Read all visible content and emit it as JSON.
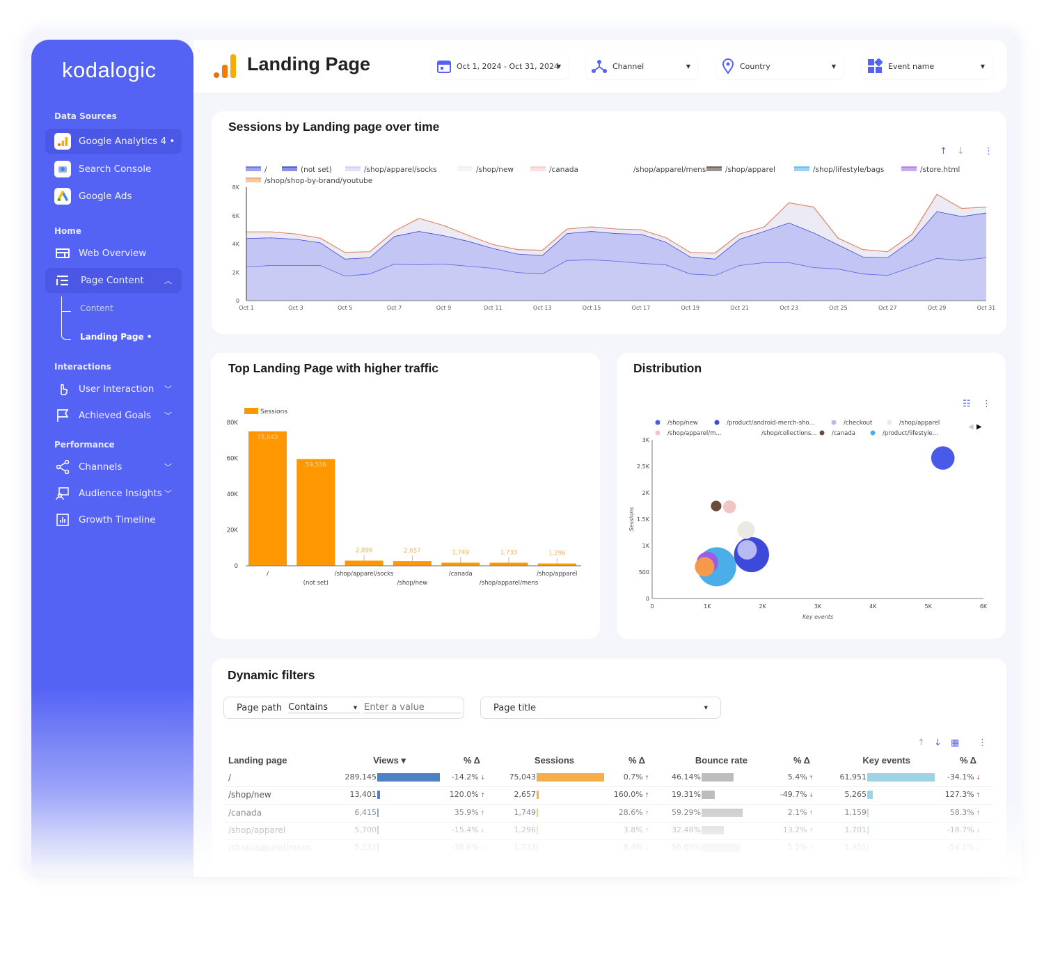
{
  "brand": "kodalogic",
  "sidebar": {
    "sections": [
      "Data Sources",
      "Home",
      "Interactions",
      "Performance"
    ],
    "data_sources": [
      {
        "label": "Google Analytics 4 •",
        "icon": "google-analytics-icon"
      },
      {
        "label": "Search Console",
        "icon": "search-console-icon"
      },
      {
        "label": "Google Ads",
        "icon": "google-ads-icon"
      }
    ],
    "home": [
      {
        "label": "Web Overview",
        "icon": "layout-icon"
      },
      {
        "label": "Page Content",
        "icon": "list-icon"
      }
    ],
    "page_content_children": [
      "Content",
      "Landing Page •"
    ],
    "interactions": [
      {
        "label": "User Interaction",
        "icon": "hand-pointer-icon"
      },
      {
        "label": "Achieved Goals",
        "icon": "flag-icon"
      }
    ],
    "performance": [
      {
        "label": "Channels",
        "icon": "share-icon"
      },
      {
        "label": "Audience Insights",
        "icon": "audience-icon"
      },
      {
        "label": "Growth Timeline",
        "icon": "bar-chart-icon"
      }
    ]
  },
  "header": {
    "title": "Landing Page",
    "filters": [
      {
        "label": "Oct 1, 2024 - Oct 31, 2024",
        "icon": "calendar-icon"
      },
      {
        "label": "Channel",
        "icon": "channel-icon"
      },
      {
        "label": "Country",
        "icon": "location-pin-icon"
      },
      {
        "label": "Event name",
        "icon": "widgets-icon"
      }
    ]
  },
  "colors": {
    "sidebar": "#5563f5",
    "accent_orange": "#ff9800",
    "table_views": "#4f81c7",
    "table_sessions": "#f6ae4a",
    "table_bounce": "#bdbdbd",
    "table_key": "#9fd3e3"
  },
  "chart_data": [
    {
      "type": "area",
      "title": "Sessions by Landing page over time",
      "stacked": true,
      "ylim": [
        0,
        8000
      ],
      "yticks": [
        "0",
        "2K",
        "4K",
        "6K",
        "8K"
      ],
      "x": [
        "Oct 1",
        "Oct 2",
        "Oct 3",
        "Oct 4",
        "Oct 5",
        "Oct 6",
        "Oct 7",
        "Oct 8",
        "Oct 9",
        "Oct 10",
        "Oct 11",
        "Oct 12",
        "Oct 13",
        "Oct 14",
        "Oct 15",
        "Oct 16",
        "Oct 17",
        "Oct 18",
        "Oct 19",
        "Oct 20",
        "Oct 21",
        "Oct 22",
        "Oct 23",
        "Oct 24",
        "Oct 25",
        "Oct 26",
        "Oct 27",
        "Oct 28",
        "Oct 29",
        "Oct 30",
        "Oct 31"
      ],
      "xticks": [
        "Oct 1",
        "Oct 3",
        "Oct 5",
        "Oct 7",
        "Oct 9",
        "Oct 11",
        "Oct 13",
        "Oct 15",
        "Oct 17",
        "Oct 19",
        "Oct 21",
        "Oct 23",
        "Oct 25",
        "Oct 27",
        "Oct 29",
        "Oct 31"
      ],
      "legend": [
        "/",
        "(not set)",
        "/shop/apparel/socks",
        "/shop/new",
        "/canada",
        "/shop/apparel/mens",
        "/shop/apparel",
        "/shop/lifestyle/bags",
        "/store.html",
        "/shop/shop-by-brand/youtube"
      ],
      "legend_colors": [
        "#5a63e0",
        "#3d47cf",
        "#c9cbf5",
        "#eeeeee",
        "#f5c9c9",
        "#ffffff",
        "#5a4a44",
        "#56b6e8",
        "#a770e8",
        "#f0a26a"
      ],
      "series": [
        {
          "name": "/",
          "color": "#5a63e0",
          "values": [
            2400,
            2500,
            2500,
            2500,
            1750,
            1900,
            2600,
            2550,
            2600,
            2450,
            2300,
            2000,
            1900,
            2850,
            2900,
            2800,
            2650,
            2550,
            1900,
            1800,
            2500,
            2700,
            2700,
            2350,
            2250,
            1900,
            1800,
            2400,
            3000,
            2850,
            3050
          ]
        },
        {
          "name": "(not set)",
          "color": "#3d47cf",
          "values": [
            2000,
            1950,
            1850,
            1600,
            1200,
            1150,
            1950,
            2350,
            2000,
            1750,
            1400,
            1300,
            1300,
            1900,
            2000,
            1950,
            2050,
            1600,
            1200,
            1150,
            1850,
            2200,
            2800,
            2450,
            1700,
            1200,
            1250,
            1900,
            3300,
            3100,
            3150
          ]
        },
        {
          "name": "/shop/new",
          "color": "#e8e8f0",
          "values": [
            350,
            300,
            250,
            200,
            350,
            300,
            250,
            800,
            600,
            300,
            150,
            200,
            250,
            200,
            200,
            200,
            200,
            200,
            200,
            300,
            250,
            200,
            1300,
            1700,
            350,
            400,
            300,
            300,
            1100,
            450,
            300
          ]
        }
      ]
    },
    {
      "type": "bar",
      "title": "Top Landing Page with higher traffic",
      "legend": [
        "Sessions"
      ],
      "ylim": [
        0,
        80000
      ],
      "yticks": [
        "0",
        "20K",
        "40K",
        "60K",
        "80K"
      ],
      "categories": [
        "/",
        "(not set)",
        "/shop/apparel/socks",
        "/shop/new",
        "/canada",
        "/shop/apparel/mens",
        "/shop/apparel"
      ],
      "values": [
        75043,
        59536,
        2896,
        2657,
        1749,
        1733,
        1296
      ],
      "labels": [
        "75,043",
        "59,536",
        "2,896",
        "2,657",
        "1,749",
        "1,733",
        "1,296"
      ]
    },
    {
      "type": "scatter",
      "title": "Distribution",
      "xlabel": "Key events",
      "ylabel": "Sessions",
      "xlim": [
        0,
        6000
      ],
      "ylim": [
        0,
        3000
      ],
      "xticks": [
        "0",
        "1K",
        "2K",
        "3K",
        "4K",
        "5K",
        "6K"
      ],
      "yticks": [
        "0",
        "500",
        "1K",
        "1.5K",
        "2K",
        "2.5K",
        "3K"
      ],
      "legend": [
        "/shop/new",
        "/product/android-merch-sho...",
        "/checkout",
        "/shop/apparel",
        "/shop/apparel/m...",
        "/shop/collections...",
        "/canada",
        "/product/lifestyle..."
      ],
      "points": [
        {
          "name": "/product/lifestyle...",
          "x": 1170,
          "y": 600,
          "size": 1.0,
          "color": "#4baee8"
        },
        {
          "name": "",
          "x": 1000,
          "y": 680,
          "size": 0.55,
          "color": "#9b5de5"
        },
        {
          "name": "",
          "x": 950,
          "y": 600,
          "size": 0.5,
          "color": "#f7994a"
        },
        {
          "name": "/product/android-merch-sho...",
          "x": 1800,
          "y": 830,
          "size": 0.9,
          "color": "#3d4ad9"
        },
        {
          "name": "/checkout",
          "x": 1720,
          "y": 920,
          "size": 0.5,
          "color": "#b6b9f2"
        },
        {
          "name": "/shop/apparel",
          "x": 1701,
          "y": 1296,
          "size": 0.45,
          "color": "#ece8e4"
        },
        {
          "name": "/shop/apparel/m...",
          "x": 1401,
          "y": 1733,
          "size": 0.33,
          "color": "#f2c5c5"
        },
        {
          "name": "/canada",
          "x": 1159,
          "y": 1749,
          "size": 0.27,
          "color": "#6b4c3b"
        },
        {
          "name": "/shop/new",
          "x": 5265,
          "y": 2657,
          "size": 0.6,
          "color": "#4a5ae8"
        }
      ]
    }
  ],
  "filters": {
    "title": "Dynamic filters",
    "page_path_label": "Page path",
    "operator": "Contains",
    "value_placeholder": "Enter a value",
    "page_title": "Page title"
  },
  "table": {
    "headers": [
      "Landing page",
      "Views ▾",
      "% Δ",
      "Sessions",
      "% Δ",
      "Bounce rate",
      "% Δ",
      "Key events",
      "% Δ"
    ],
    "rows": [
      {
        "page": "/",
        "views": "289,145",
        "views_v": 289145,
        "vd": "-14.2%",
        "vu": false,
        "sessions": "75,043",
        "sessions_v": 75043,
        "sd": "0.7%",
        "su": true,
        "bounce": "46.14%",
        "bounce_v": 46.14,
        "bd": "5.4%",
        "bu": true,
        "key": "61,951",
        "key_v": 61951,
        "kd": "-34.1%",
        "ku": false
      },
      {
        "page": "/shop/new",
        "views": "13,401",
        "views_v": 13401,
        "vd": "120.0%",
        "vu": true,
        "sessions": "2,657",
        "sessions_v": 2657,
        "sd": "160.0%",
        "su": true,
        "bounce": "19.31%",
        "bounce_v": 19.31,
        "bd": "-49.7%",
        "bu": false,
        "key": "5,265",
        "key_v": 5265,
        "kd": "127.3%",
        "ku": true
      },
      {
        "page": "/canada",
        "views": "6,415",
        "views_v": 6415,
        "vd": "35.9%",
        "vu": true,
        "sessions": "1,749",
        "sessions_v": 1749,
        "sd": "28.6%",
        "su": true,
        "bounce": "59.29%",
        "bounce_v": 59.29,
        "bd": "2.1%",
        "bu": true,
        "key": "1,159",
        "key_v": 1159,
        "kd": "58.3%",
        "ku": true
      },
      {
        "page": "/shop/apparel",
        "views": "5,700",
        "views_v": 5700,
        "vd": "-15.4%",
        "vu": false,
        "sessions": "1,296",
        "sessions_v": 1296,
        "sd": "3.8%",
        "su": true,
        "bounce": "32.48%",
        "bounce_v": 32.48,
        "bd": "13.2%",
        "bu": true,
        "key": "1,701",
        "key_v": 1701,
        "kd": "-18.7%",
        "ku": false
      },
      {
        "page": "/shop/apparel/mens",
        "views": "5,231",
        "views_v": 5231,
        "vd": "-38.6%",
        "vu": false,
        "sessions": "1,733",
        "sessions_v": 1733,
        "sd": "-8.4%",
        "su": false,
        "bounce": "56.09%",
        "bounce_v": 56.09,
        "bd": "5.2%",
        "bu": true,
        "key": "1,401",
        "key_v": 1401,
        "kd": "-54.1%",
        "ku": false
      }
    ]
  }
}
